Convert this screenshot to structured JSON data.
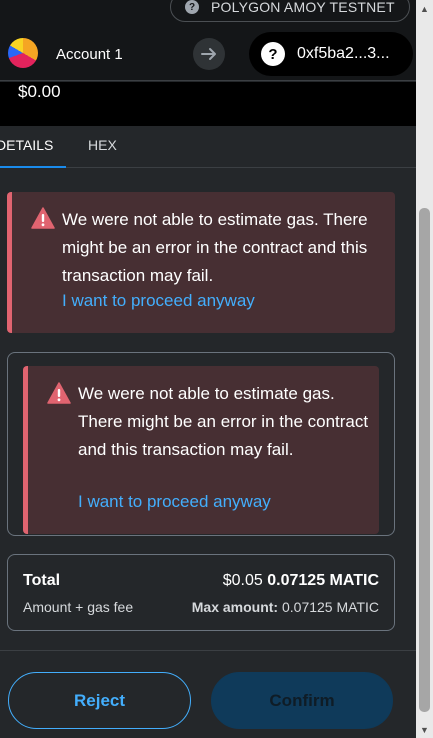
{
  "network": {
    "name": "POLYGON AMOY TESTNET",
    "icon": "question-icon"
  },
  "header": {
    "account_name": "Account 1",
    "recipient_address": "0xf5ba2...3...",
    "recipient_icon_glyph": "?"
  },
  "amount": {
    "fiat": "$0.00"
  },
  "tabs": [
    {
      "label": "DETAILS",
      "active": true
    },
    {
      "label": "HEX",
      "active": false
    }
  ],
  "alerts": [
    {
      "message": "We were not able to estimate gas. There might be an error in the contract and this transaction may fail.",
      "link": "I want to proceed anyway"
    },
    {
      "message": "We were not able to estimate gas. There might be an error in the contract and this transaction may fail.",
      "link": "I want to proceed anyway"
    }
  ],
  "total": {
    "label": "Total",
    "sublabel": "Amount + gas fee",
    "fiat": "$0.05",
    "crypto": "0.07125 MATIC",
    "max_label": "Max amount:",
    "max_value": "0.07125 MATIC"
  },
  "footer": {
    "reject_label": "Reject",
    "confirm_label": "Confirm"
  },
  "colors": {
    "accent": "#43aefc",
    "danger": "#e06470",
    "alert_bg": "#472f33",
    "background": "#24272a"
  }
}
